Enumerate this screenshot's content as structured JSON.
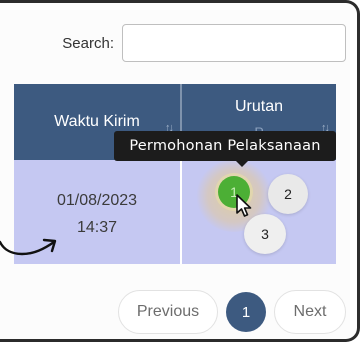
{
  "search": {
    "label": "Search:",
    "value": ""
  },
  "table": {
    "headers": [
      {
        "label": "Waktu Kirim"
      },
      {
        "label": "Urutan",
        "sub": "P"
      }
    ],
    "rows": [
      {
        "date": "01/08/2023",
        "time": "14:37",
        "steps": [
          "1",
          "2",
          "3"
        ]
      }
    ]
  },
  "tooltip": {
    "text": "Permohonan Pelaksanaan"
  },
  "pagination": {
    "previous": "Previous",
    "current": "1",
    "next": "Next"
  },
  "colors": {
    "header": "#3d5a80",
    "row": "#c5c8f2",
    "active_step": "#4caf35"
  }
}
